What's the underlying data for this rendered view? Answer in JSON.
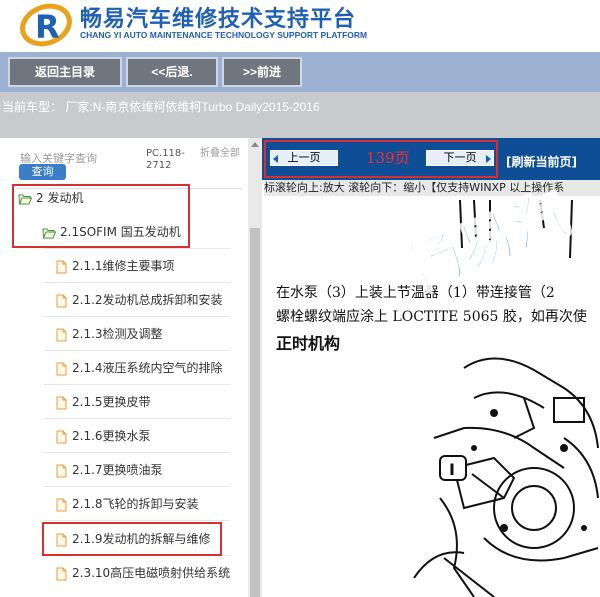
{
  "header": {
    "title": "畅易汽车维修技术支持平台",
    "subtitle": "CHANG YI AUTO MAINTENANCE TECHNOLOGY SUPPORT PLATFORM"
  },
  "nav": {
    "home": "返回主目录",
    "back": "<<后退.",
    "forward": ">>前进"
  },
  "info": {
    "current_model": "当前车型：  厂家:N-南京依维柯依维柯Turbo Daily2015-2016"
  },
  "search": {
    "placeholder": "输入关键字查询",
    "button": "查询",
    "pc_code": "PC.118-2712",
    "collapse_all": "折叠全部"
  },
  "tree": [
    {
      "label": "2 发动机",
      "type": "folder"
    },
    {
      "label": "2.1SOFIM 国五发动机",
      "type": "folder"
    },
    {
      "label": "2.1.1维修主要事项",
      "type": "doc"
    },
    {
      "label": "2.1.2发动机总成拆卸和安装",
      "type": "doc"
    },
    {
      "label": "2.1.3检测及调整",
      "type": "doc"
    },
    {
      "label": "2.1.4液压系统内空气的排除",
      "type": "doc"
    },
    {
      "label": "2.1.5更换皮带",
      "type": "doc"
    },
    {
      "label": "2.1.6更换水泵",
      "type": "doc"
    },
    {
      "label": "2.1.7更换喷油泵",
      "type": "doc"
    },
    {
      "label": "2.1.8飞轮的拆卸与安装",
      "type": "doc"
    },
    {
      "label": "2.1.9发动机的拆解与维修",
      "type": "doc"
    },
    {
      "label": "2.3.10高压电磁喷射供给系统",
      "type": "doc"
    }
  ],
  "pager": {
    "prev": "上一页",
    "next": "下一页",
    "page": "139页",
    "refresh": "[刷新当前页]"
  },
  "hint": "标滚轮向上:放大  滚轮向下：缩小【仅支持WINXP 以上操作系",
  "document": {
    "line1": "在水泵（3）上装上节温器（1）带连接管（2",
    "line2": "螺栓螺纹端应涂上 LOCTITE 5065 胶，如再次使",
    "heading": "正时机构",
    "callout": "I",
    "watermark": "畅易汽"
  },
  "colors": {
    "brand_blue": "#1f5fb4",
    "page_bar": "#0e4e96",
    "highlight_red": "#d63030",
    "page_number": "#ff2a2a"
  }
}
